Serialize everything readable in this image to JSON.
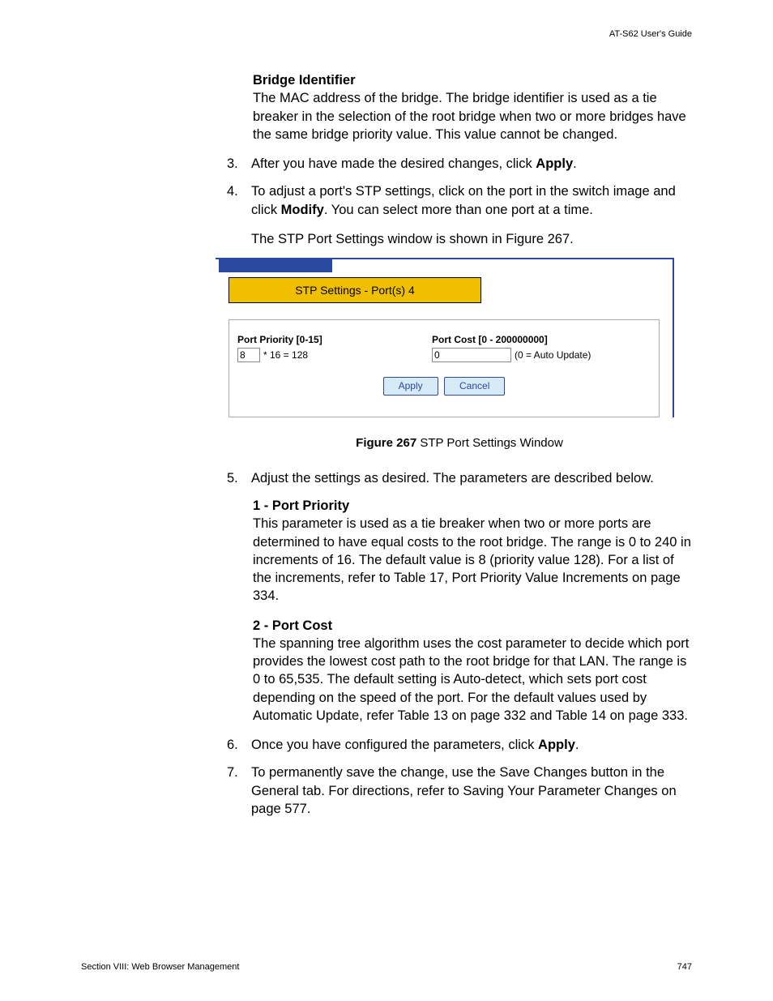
{
  "header": {
    "guide": "AT-S62 User's Guide"
  },
  "bridge": {
    "title": "Bridge Identifier",
    "body": "The MAC address of the bridge. The bridge identifier is used as a tie breaker in the selection of the root bridge when two or more bridges have the same bridge priority value. This value cannot be changed."
  },
  "steps": {
    "s3_num": "3.",
    "s3a": "After you have made the desired changes, click ",
    "s3b": "Apply",
    "s3c": ".",
    "s4_num": "4.",
    "s4a": "To adjust a port's STP settings, click on the port in the switch image and click ",
    "s4b": "Modify",
    "s4c": ". You can select more than one port at a time.",
    "s4_note": "The STP Port Settings window is shown in Figure 267.",
    "s5_num": "5.",
    "s5": "Adjust the settings as desired. The parameters are described below.",
    "s6_num": "6.",
    "s6a": "Once you have configured the parameters, click ",
    "s6b": "Apply",
    "s6c": ".",
    "s7_num": "7.",
    "s7": "To permanently save the change, use the Save Changes button in the General tab. For directions, refer to Saving Your Parameter Changes on page 577."
  },
  "figure": {
    "title": "STP Settings - Port(s) 4",
    "priority_label": "Port Priority [0-15]",
    "priority_value": "8",
    "priority_note": "* 16 = 128",
    "cost_label": "Port Cost [0 - 200000000]",
    "cost_value": "0",
    "cost_note": "(0 = Auto Update)",
    "apply": "Apply",
    "cancel": "Cancel",
    "caption_bold": "Figure 267",
    "caption_rest": "  STP Port Settings Window"
  },
  "params": {
    "p1_title": "1 - Port Priority",
    "p1_body": "This parameter is used as a tie breaker when two or more ports are determined to have equal costs to the root bridge. The range is 0 to 240 in increments of 16. The default value is 8 (priority value 128). For a list of the increments, refer to Table 17, Port Priority Value Increments on page 334.",
    "p2_title": "2 - Port Cost",
    "p2_body": "The spanning tree algorithm uses the cost parameter to decide which port provides the lowest cost path to the root bridge for that LAN. The range is 0 to 65,535. The default setting is Auto-detect, which sets port cost depending on the speed of the port. For the default values used by Automatic Update, refer Table 13 on page 332 and Table 14 on page 333."
  },
  "footer": {
    "section": "Section VIII: Web Browser Management",
    "page": "747"
  }
}
